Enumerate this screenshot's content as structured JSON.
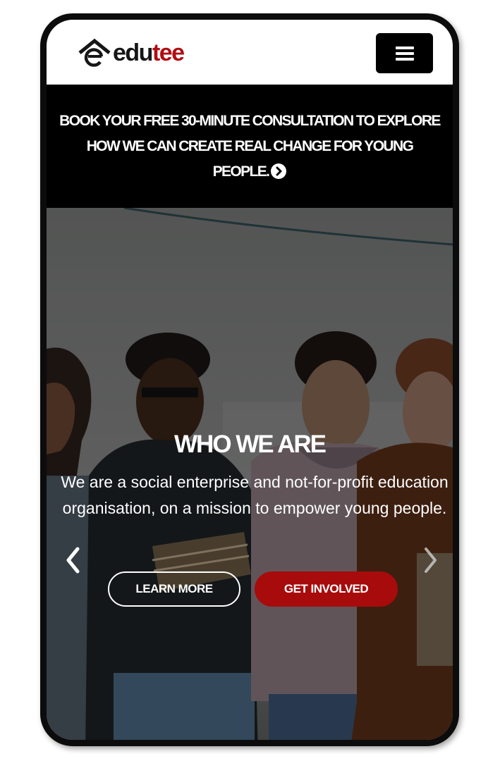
{
  "header": {
    "logo": {
      "text_dark": "edu",
      "text_accent": "tee",
      "dark_color": "#161616",
      "accent_color": "#b10d12"
    },
    "menu_icon": "hamburger-icon"
  },
  "banner": {
    "text": "BOOK YOUR FREE 30-MINUTE CONSULTATION TO EXPLORE HOW WE CAN CREATE REAL CHANGE FOR YOUNG PEOPLE.",
    "icon": "arrow-right-circle-icon"
  },
  "hero": {
    "image": "group-of-students-photo",
    "title": "WHO WE ARE",
    "description": "We are a social enterprise and not-for-profit education organisation, on a mission to empower young people.",
    "prev_icon": "chevron-left-icon",
    "next_icon": "chevron-right-icon",
    "buttons": {
      "learn_more": "LEARN MORE",
      "get_involved": "GET INVOLVED"
    },
    "accent_color": "#a80b0b"
  }
}
